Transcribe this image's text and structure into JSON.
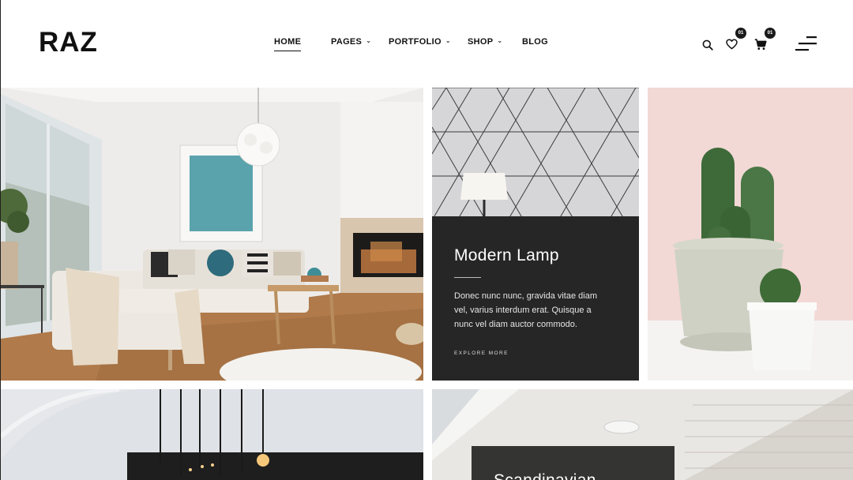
{
  "brand": {
    "logo": "RAZ"
  },
  "nav": {
    "items": [
      {
        "label": "HOME",
        "has_dropdown": false,
        "active": true
      },
      {
        "label": "PAGES",
        "has_dropdown": true,
        "active": false
      },
      {
        "label": "PORTFOLIO",
        "has_dropdown": true,
        "active": false
      },
      {
        "label": "SHOP",
        "has_dropdown": true,
        "active": false
      },
      {
        "label": "BLOG",
        "has_dropdown": false,
        "active": false
      }
    ]
  },
  "header_icons": {
    "search": "search-icon",
    "wishlist": {
      "icon": "heart-icon",
      "count": "01"
    },
    "cart": {
      "icon": "cart-icon",
      "count": "01"
    },
    "menu": "hamburger-menu-icon"
  },
  "featured": {
    "title": "Modern Lamp",
    "description": "Donec nunc nunc, gravida vitae diam vel, varius interdum erat. Quisque a nunc vel diam auctor commodo.",
    "link": "EXPLORE MORE"
  },
  "second_card": {
    "title": "Scandinavian"
  },
  "colors": {
    "overlay": "#262626",
    "cactus_bg": "#f2d9d6",
    "text": "#111111"
  }
}
